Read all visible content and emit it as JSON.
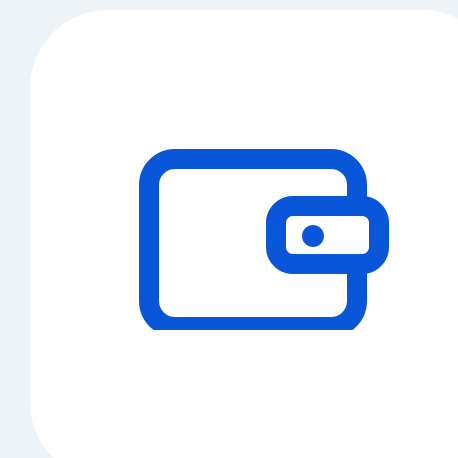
{
  "app_icon": {
    "icon": "wallet-icon",
    "colors": {
      "background": "#eef3f8",
      "tile": "#ffffff",
      "accent": "#0a56d8"
    }
  }
}
